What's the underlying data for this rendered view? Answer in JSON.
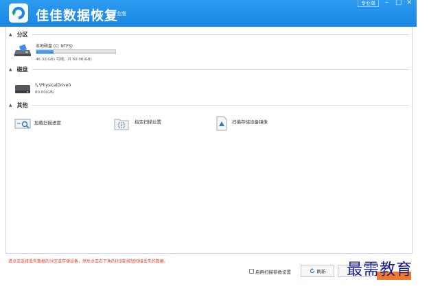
{
  "titlebar": {
    "app_title": "佳佳数据恢复",
    "edition": "专业版",
    "edition_button": "专业单",
    "minimize_glyph": "–",
    "restore_glyph": "□",
    "close_glyph": "×"
  },
  "sections": {
    "partition": {
      "title": "分区"
    },
    "disk": {
      "title": "磁盘"
    },
    "other": {
      "title": "其他"
    }
  },
  "partition_drive": {
    "name": "本地磁盘 (C: NTFS)",
    "size": "46.32(GB) 可用，共 60.00(GB)",
    "usage_fraction": 0.22
  },
  "physical_drive": {
    "name": "\\\\.\\PhysicalDrive0",
    "size": "60.00(GB)"
  },
  "other_items": [
    {
      "label": "加载扫描进度",
      "icon": "magnifier-scan-icon"
    },
    {
      "label": "指定扫描位置",
      "icon": "folder-target-icon"
    },
    {
      "label": "扫描存储设备镜像",
      "icon": "disk-image-icon"
    }
  ],
  "footer": {
    "status_text": "请点击选择丢失数据的分区或存储设备，然后点击右下角的[扫描]按钮扫描丢失的数据。",
    "checkbox_label": "启用扫描参数设置",
    "refresh_label": "刷新"
  },
  "watermark": "最需教育",
  "colors": {
    "titlebar": "#1a86e3",
    "status_text": "#e03a28",
    "next_button": "#f07a2a",
    "watermark": "#1a1f8c"
  }
}
